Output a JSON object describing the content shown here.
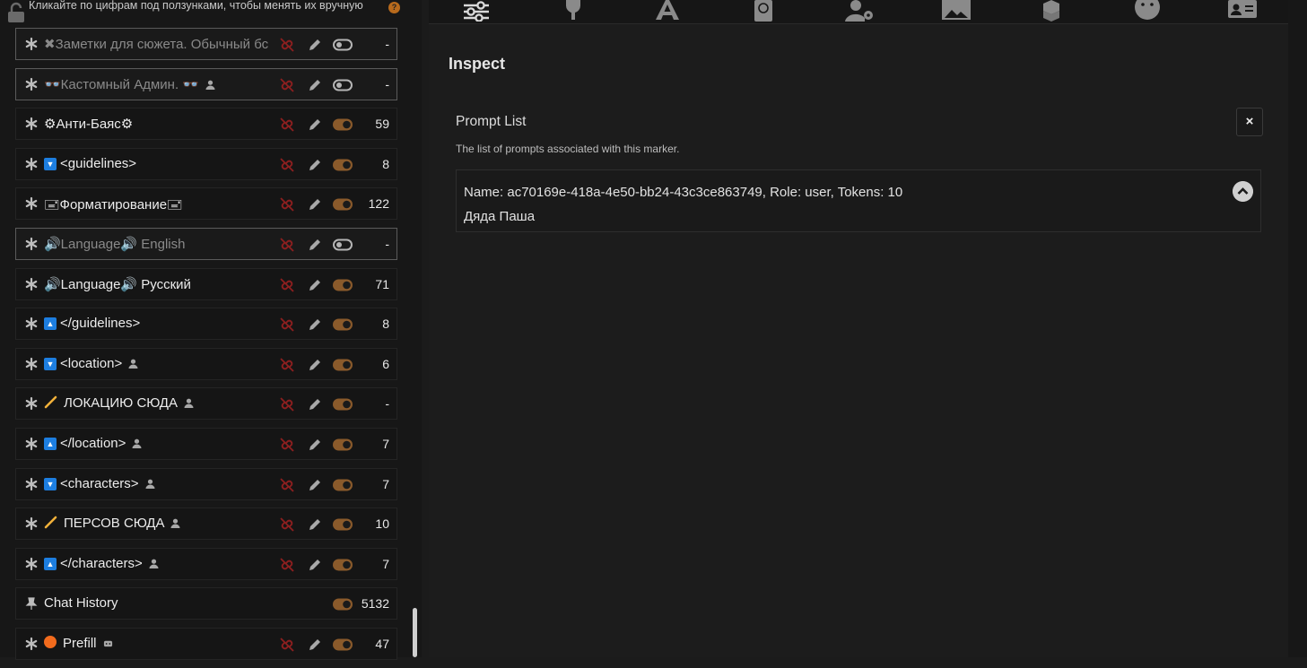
{
  "top_note": {
    "text": "Кликайте по цифрам под ползунками, чтобы менять их вручную",
    "badge": "?"
  },
  "prompts": [
    {
      "name": "✖Заметки для сюжета. Обычный бс",
      "tokens": "-",
      "enabled": false,
      "user": false,
      "marker": "",
      "pin": false
    },
    {
      "name": "👓Кастомный Админ. 👓",
      "tokens": "-",
      "enabled": false,
      "user": true,
      "marker": "",
      "pin": false
    },
    {
      "name": "⚙Анти-Баяс⚙",
      "tokens": "59",
      "enabled": true,
      "user": false,
      "marker": "",
      "pin": false
    },
    {
      "name": "<guidelines>",
      "tokens": "8",
      "enabled": true,
      "user": false,
      "marker": "down",
      "pin": false
    },
    {
      "name": "🖃Форматирование🖃",
      "tokens": "122",
      "enabled": true,
      "user": false,
      "marker": "",
      "pin": false
    },
    {
      "name": "🔊Language🔊 English",
      "tokens": "-",
      "enabled": false,
      "user": false,
      "marker": "",
      "pin": false
    },
    {
      "name": "🔊Language🔊 Русский",
      "tokens": "71",
      "enabled": true,
      "user": false,
      "marker": "",
      "pin": false
    },
    {
      "name": "</guidelines>",
      "tokens": "8",
      "enabled": true,
      "user": false,
      "marker": "up",
      "pin": false
    },
    {
      "name": "<location>",
      "tokens": "6",
      "enabled": true,
      "user": true,
      "marker": "down",
      "pin": false
    },
    {
      "name": "ЛОКАЦИЮ СЮДА",
      "tokens": "-",
      "enabled": true,
      "user": true,
      "marker": "pencil",
      "pin": false
    },
    {
      "name": "</location>",
      "tokens": "7",
      "enabled": true,
      "user": true,
      "marker": "up",
      "pin": false
    },
    {
      "name": "<characters>",
      "tokens": "7",
      "enabled": true,
      "user": true,
      "marker": "down",
      "pin": false
    },
    {
      "name": "ПЕРСОВ СЮДА",
      "tokens": "10",
      "enabled": true,
      "user": true,
      "marker": "pencil",
      "pin": false
    },
    {
      "name": "</characters>",
      "tokens": "7",
      "enabled": true,
      "user": true,
      "marker": "up",
      "pin": false
    },
    {
      "name": "Chat History",
      "tokens": "5132",
      "enabled": true,
      "user": false,
      "marker": "",
      "pin": true
    },
    {
      "name": "Prefill",
      "tokens": "47",
      "enabled": true,
      "user": false,
      "marker": "dot",
      "pin": false,
      "bot": true
    }
  ],
  "tabs": [
    "sliders-icon",
    "plug-icon",
    "font-icon",
    "book-icon",
    "user-gear-icon",
    "image-icon",
    "cubes-icon",
    "smile-icon",
    "id-card-icon"
  ],
  "inspect": {
    "title": "Inspect",
    "prompt_list_title": "Prompt List",
    "prompt_list_desc": "The list of prompts associated with this marker.",
    "close": "×",
    "entry_line1": "Name: ac70169e-418a-4e50-bb24-43c3ce863749, Role: user, Tokens: 10",
    "entry_line2": "Дяда Паша"
  },
  "colors": {
    "accent_toggle": "#8a5a2b",
    "unlink_red": "#8c1f1f",
    "marker_blue": "#1d7ee0"
  }
}
